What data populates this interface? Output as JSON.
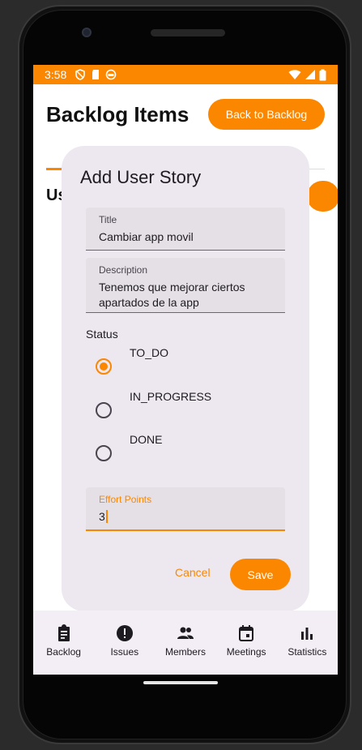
{
  "statusbar": {
    "time": "3:58"
  },
  "page": {
    "title": "Backlog Items",
    "back_button": "Back to Backlog",
    "behind_text": "Us"
  },
  "dialog": {
    "title": "Add User Story",
    "title_field": {
      "label": "Title",
      "value": "Cambiar app movil"
    },
    "description_field": {
      "label": "Description",
      "value": "Tenemos que mejorar ciertos apartados de la app"
    },
    "status_label": "Status",
    "status_options": [
      {
        "label": "TO_DO",
        "selected": true
      },
      {
        "label": "IN_PROGRESS",
        "selected": false
      },
      {
        "label": "DONE",
        "selected": false
      }
    ],
    "effort_field": {
      "label": "Effort Points",
      "value": "3"
    },
    "cancel_label": "Cancel",
    "save_label": "Save"
  },
  "bottom_nav": [
    {
      "label": "Backlog",
      "icon": "clipboard-icon"
    },
    {
      "label": "Issues",
      "icon": "alert-circle-icon"
    },
    {
      "label": "Members",
      "icon": "people-icon"
    },
    {
      "label": "Meetings",
      "icon": "calendar-icon"
    },
    {
      "label": "Statistics",
      "icon": "bar-chart-icon"
    }
  ],
  "colors": {
    "accent": "#fb8700",
    "dialog_bg": "#ede7f0",
    "nav_bg": "#f3edf6"
  }
}
